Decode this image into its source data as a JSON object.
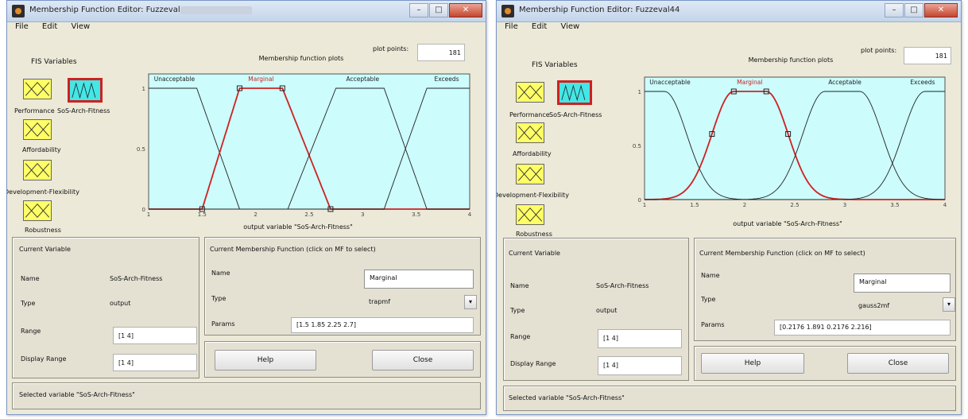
{
  "windows": [
    {
      "title": "Membership Function Editor: Fuzzeval44",
      "menu": [
        "File",
        "Edit",
        "View"
      ],
      "fis_variables_label": "FIS Variables",
      "variables": [
        {
          "label": "Performance",
          "selected": false
        },
        {
          "label": "SoS-Arch-Fitness",
          "selected": true
        },
        {
          "label": "Affordability",
          "selected": false
        },
        {
          "label": "Development-Flexibility",
          "selected": false
        },
        {
          "label": "Robustness",
          "selected": false
        }
      ],
      "plot_title": "Membership function plots",
      "plot_points_label": "plot points:",
      "plot_points_value": "181",
      "mf_names": [
        "Unacceptable",
        "Marginal",
        "Acceptable",
        "Exceeds"
      ],
      "y_ticks": [
        "1",
        "0.5",
        "0"
      ],
      "x_ticks": [
        "1",
        "1.5",
        "2",
        "2.5",
        "3",
        "3.5",
        "4"
      ],
      "xlabel": "output variable \"SoS-Arch-Fitness\"",
      "curve_type": "trapmf",
      "current_variable": {
        "title": "Current Variable",
        "name_label": "Name",
        "name_value": "SoS-Arch-Fitness",
        "type_label": "Type",
        "type_value": "output",
        "range_label": "Range",
        "range_value": "[1 4]",
        "display_range_label": "Display Range",
        "display_range_value": "[1 4]"
      },
      "current_mf": {
        "title": "Current Membership Function (click on MF to select)",
        "name_label": "Name",
        "name_value": "Marginal",
        "type_label": "Type",
        "type_value": "trapmf",
        "params_label": "Params",
        "params_value": "[1.5 1.85 2.25 2.7]"
      },
      "help_label": "Help",
      "close_label": "Close",
      "status": "Selected variable \"SoS-Arch-Fitness\""
    },
    {
      "title": "Membership Function Editor: Fuzzeval44",
      "menu": [
        "File",
        "Edit",
        "View"
      ],
      "fis_variables_label": "FIS Variables",
      "variables": [
        {
          "label": "Performance",
          "selected": false
        },
        {
          "label": "SoS-Arch-Fitness",
          "selected": true
        },
        {
          "label": "Affordability",
          "selected": false
        },
        {
          "label": "Development-Flexibility",
          "selected": false
        },
        {
          "label": "Robustness",
          "selected": false
        }
      ],
      "plot_title": "Membership function plots",
      "plot_points_label": "plot points:",
      "plot_points_value": "181",
      "mf_names": [
        "Unacceptable",
        "Marginal",
        "Acceptable",
        "Exceeds"
      ],
      "y_ticks": [
        "1",
        "0.5",
        "0"
      ],
      "x_ticks": [
        "1",
        "1.5",
        "2",
        "2.5",
        "3",
        "3.5",
        "4"
      ],
      "xlabel": "output variable \"SoS-Arch-Fitness\"",
      "curve_type": "gauss2mf",
      "current_variable": {
        "title": "Current Variable",
        "name_label": "Name",
        "name_value": "SoS-Arch-Fitness",
        "type_label": "Type",
        "type_value": "output",
        "range_label": "Range",
        "range_value": "[1 4]",
        "display_range_label": "Display Range",
        "display_range_value": "[1 4]"
      },
      "current_mf": {
        "title": "Current Membership Function (click on MF to select)",
        "name_label": "Name",
        "name_value": "Marginal",
        "type_label": "Type",
        "type_value": "gauss2mf",
        "params_label": "Params",
        "params_value": "[0.2176 1.891 0.2176 2.216]"
      },
      "help_label": "Help",
      "close_label": "Close",
      "status": "Selected variable \"SoS-Arch-Fitness\""
    }
  ],
  "colors": {
    "plot_bg": "#ccfcfc",
    "selected_mf": "#d02020",
    "mf_line": "#222222",
    "input_var_fill": "#ffff66",
    "output_var_fill": "#44e6e6"
  },
  "icons": [
    "matlab-app-icon",
    "minimize-icon",
    "maximize-icon",
    "close-icon",
    "dropdown-arrow-icon"
  ]
}
